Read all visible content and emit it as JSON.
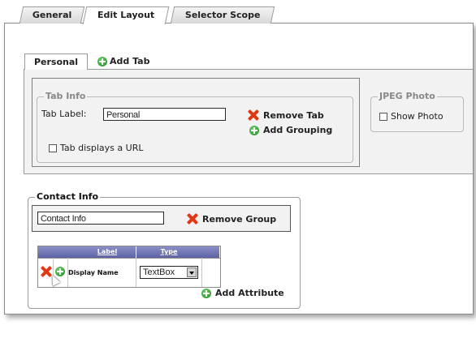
{
  "tabs": {
    "general": "General",
    "edit_layout": "Edit Layout",
    "selector_scope": "Selector Scope"
  },
  "subtabs": {
    "personal": "Personal",
    "add_tab": "Add Tab"
  },
  "tab_info": {
    "legend": "Tab Info",
    "tab_label_caption": "Tab Label:",
    "tab_label_value": "Personal",
    "remove_tab": "Remove Tab",
    "add_grouping": "Add Grouping",
    "url_checkbox_label": "Tab displays a URL",
    "url_checked": false
  },
  "jpeg_photo": {
    "legend": "JPEG Photo",
    "show_photo_label": "Show Photo",
    "show_photo_checked": false
  },
  "contact_info": {
    "legend": "Contact Info",
    "group_name_value": "Contact Info",
    "remove_group": "Remove Group"
  },
  "attribute_grid": {
    "headers": [
      "Label",
      "Type"
    ],
    "rows": [
      {
        "label": "Display Name",
        "type": "TextBox"
      }
    ],
    "add_attribute": "Add Attribute"
  },
  "colors": {
    "accent_green": "#1d8a1d",
    "remove_red": "#e03a14",
    "grid_header": "#6a6fb2"
  },
  "icons": [
    "plus-circle-icon",
    "remove-x-icon",
    "dropdown-arrow-icon",
    "mouse-cursor-icon"
  ]
}
